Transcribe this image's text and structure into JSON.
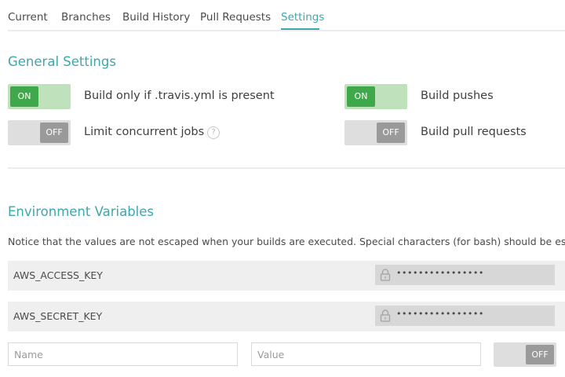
{
  "tabs": [
    {
      "label": "Current"
    },
    {
      "label": "Branches"
    },
    {
      "label": "Build History"
    },
    {
      "label": "Pull Requests"
    },
    {
      "label": "Settings",
      "active": true
    }
  ],
  "general": {
    "title": "General Settings",
    "settings": [
      {
        "label": "Build only if .travis.yml is present",
        "state": "ON"
      },
      {
        "label": "Build pushes",
        "state": "ON"
      },
      {
        "label": "Limit concurrent jobs",
        "state": "OFF",
        "help": "?"
      },
      {
        "label": "Build pull requests",
        "state": "OFF"
      }
    ]
  },
  "env": {
    "title": "Environment Variables",
    "notice": "Notice that the values are not escaped when your builds are executed. Special characters (for bash) should be escaped acco",
    "vars": [
      {
        "name": "AWS_ACCESS_KEY",
        "value": "••••••••••••••••"
      },
      {
        "name": "AWS_SECRET_KEY",
        "value": "••••••••••••••••"
      }
    ],
    "new_var": {
      "name_placeholder": "Name",
      "value_placeholder": "Value",
      "public_toggle": "OFF"
    }
  },
  "colors": {
    "accent": "#3ea6ad",
    "toggle_on": "#3fa84a",
    "toggle_off": "#9a9a9a"
  }
}
